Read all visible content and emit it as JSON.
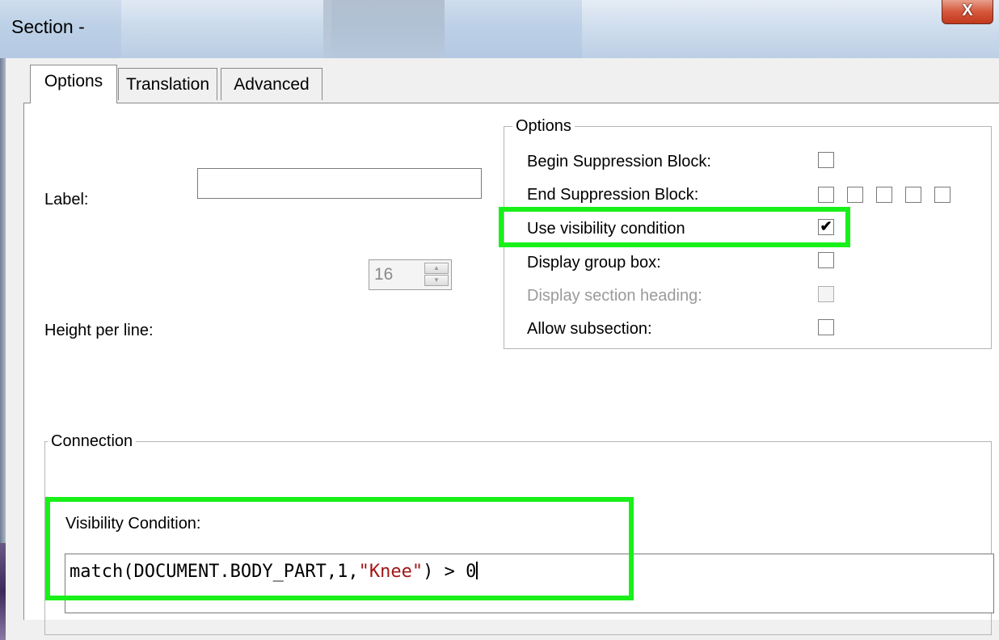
{
  "window": {
    "title": "Section -",
    "close_glyph": "X"
  },
  "tabs": [
    "Options",
    "Translation",
    "Advanced"
  ],
  "form": {
    "label_label": "Label:",
    "label_value": "",
    "height_label": "Height per line:",
    "height_value": "16"
  },
  "options_group": {
    "title": "Options",
    "items": [
      {
        "label": "Begin Suppression Block:",
        "checked": false,
        "enabled": true
      },
      {
        "label": "End Suppression Block:",
        "checked": false,
        "enabled": true,
        "extra_checkboxes": 4
      },
      {
        "label": "Use visibility condition",
        "checked": true,
        "enabled": true,
        "highlighted": true
      },
      {
        "label": "Display group box:",
        "checked": false,
        "enabled": true
      },
      {
        "label": "Display section heading:",
        "checked": false,
        "enabled": false
      },
      {
        "label": "Allow subsection:",
        "checked": false,
        "enabled": true
      }
    ]
  },
  "connection_group": {
    "title": "Connection",
    "visibility_label": "Visibility Condition:",
    "code": {
      "prefix": "match(DOCUMENT.BODY_PART,1,",
      "string": "\"Knee\"",
      "suffix": ") > 0",
      "string_color": "#a31515"
    }
  },
  "colors": {
    "highlight": "#19f019",
    "titlebar": "#bcd0e6",
    "close": "#c2391c"
  }
}
